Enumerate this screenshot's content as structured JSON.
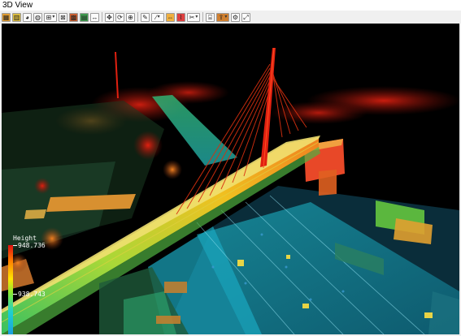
{
  "window": {
    "title": "3D View"
  },
  "toolbar": {
    "buttons": [
      {
        "name": "layers-icon",
        "glyph": "▦"
      },
      {
        "name": "height-color-icon",
        "glyph": "▥"
      },
      {
        "name": "color-wheel-icon",
        "glyph": "◕"
      },
      {
        "name": "rgb-sphere-icon",
        "glyph": "◍"
      },
      {
        "name": "display-mode-icon",
        "glyph": "⊞"
      },
      {
        "name": "class-display-icon",
        "glyph": "⊠"
      },
      {
        "name": "intensity-icon",
        "glyph": "▩"
      },
      {
        "name": "elevation-icon",
        "glyph": "▤"
      },
      {
        "name": "measure-icon",
        "glyph": "↔"
      },
      {
        "name": "pan-icon",
        "glyph": "✥"
      },
      {
        "name": "rotate-icon",
        "glyph": "⟳"
      },
      {
        "name": "zoom-icon",
        "glyph": "⊕"
      },
      {
        "name": "pick-point-icon",
        "glyph": "✎"
      },
      {
        "name": "draw-line-icon",
        "glyph": "∕"
      },
      {
        "name": "section-icon",
        "glyph": "⇔"
      },
      {
        "name": "profile-icon",
        "glyph": "⌇"
      },
      {
        "name": "clip-icon",
        "glyph": "✂"
      },
      {
        "name": "fence-icon",
        "glyph": "⌸"
      },
      {
        "name": "export-icon",
        "glyph": "⇪"
      },
      {
        "name": "settings-icon",
        "glyph": "⚙"
      },
      {
        "name": "fit-view-icon",
        "glyph": "⤢"
      }
    ]
  },
  "legend": {
    "title": "Height",
    "max": "948.736",
    "min": "938.743"
  },
  "colors": {
    "high": "#e01010",
    "mid_high": "#ff8000",
    "mid": "#ffe600",
    "mid_low": "#7ee83a",
    "low": "#1ecfd0",
    "lowest": "#1a9fe0"
  }
}
